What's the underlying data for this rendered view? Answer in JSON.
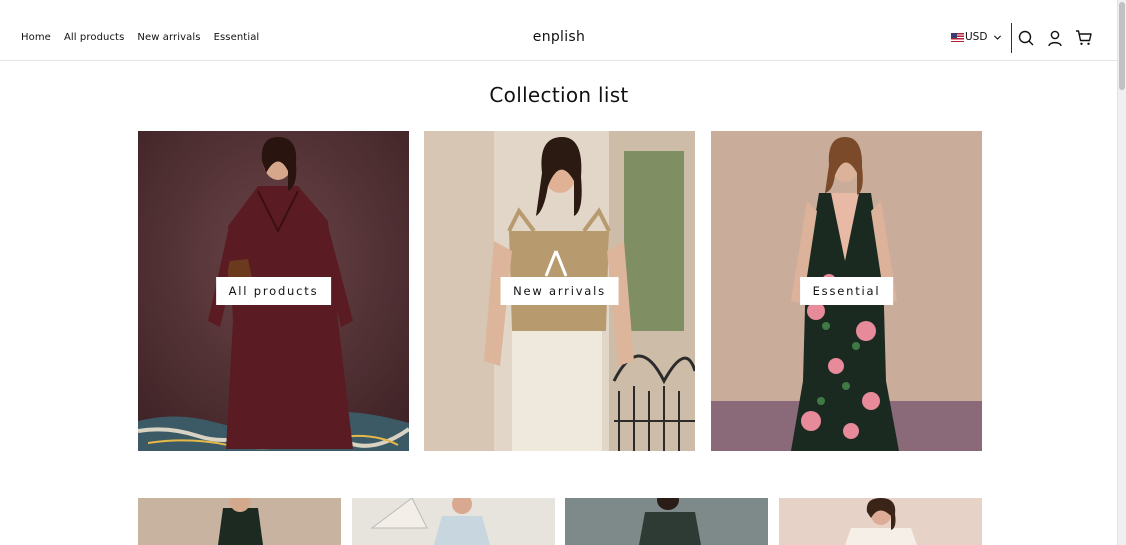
{
  "nav": {
    "items": [
      "Home",
      "All products",
      "New arrivals",
      "Essential"
    ]
  },
  "brand": {
    "name": "enplish"
  },
  "currency": {
    "code": "USD"
  },
  "icons": [
    "search-icon",
    "account-icon",
    "cart-icon"
  ],
  "page": {
    "title": "Collection list"
  },
  "collections": [
    {
      "label": "All products",
      "photo_bg": "#4a2a2c",
      "dress_color": "#5a1c22"
    },
    {
      "label": "New arrivals",
      "photo_bg": "#d9c8b4",
      "top_color": "#b79a6e"
    },
    {
      "label": "Essential",
      "photo_bg": "#c9ad9a",
      "dress_color": "#1a2a20"
    }
  ]
}
